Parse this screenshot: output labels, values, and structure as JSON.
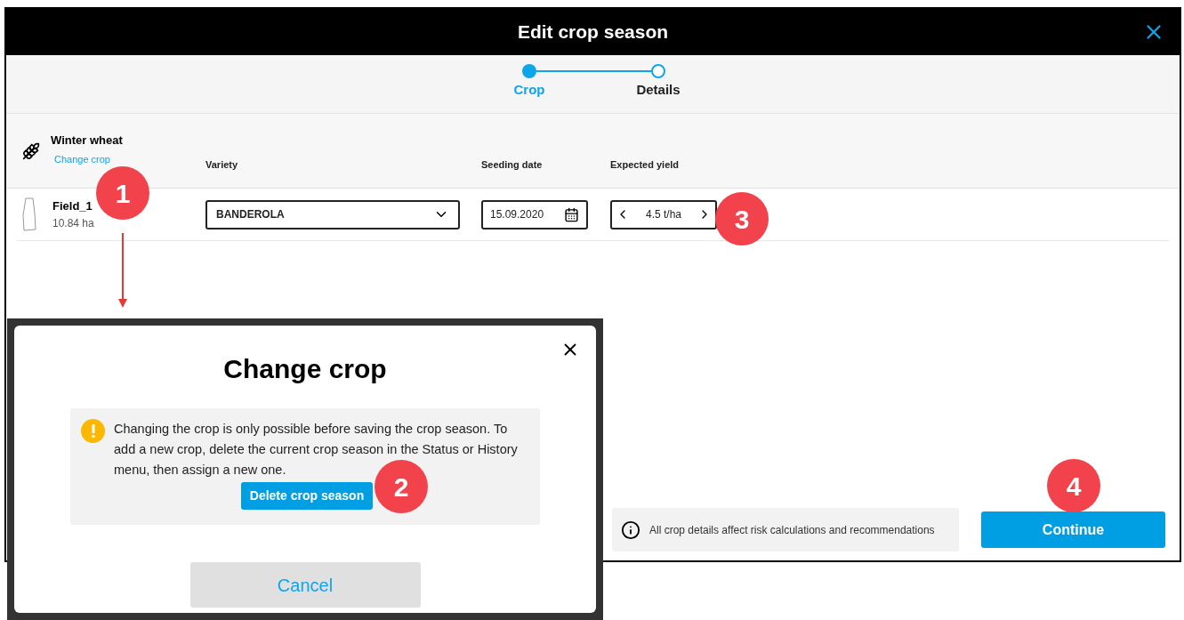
{
  "window": {
    "title": "Edit crop season"
  },
  "stepper": [
    {
      "label": "Crop",
      "selected": true
    },
    {
      "label": "Details",
      "selected": false
    }
  ],
  "crop": {
    "name": "Winter wheat",
    "change_link": "Change crop"
  },
  "columns": [
    "Variety",
    "Seeding date",
    "Expected yield"
  ],
  "field": {
    "name": "Field_1",
    "area": "10.84 ha",
    "variety": "BANDEROLA",
    "seeding_date": "15.09.2020",
    "expected_yield": "4.5 t/ha"
  },
  "info": "All crop details affect risk calculations and recommendations",
  "continue_button": "Continue",
  "dialog": {
    "title": "Change crop",
    "message": "Changing the crop is only possible before saving the crop season. To add a new crop, delete the current crop season in the Status or History menu, then assign a new one.",
    "delete_button": "Delete crop season",
    "cancel_button": "Cancel"
  },
  "annotations": [
    "1",
    "2",
    "3",
    "4"
  ]
}
